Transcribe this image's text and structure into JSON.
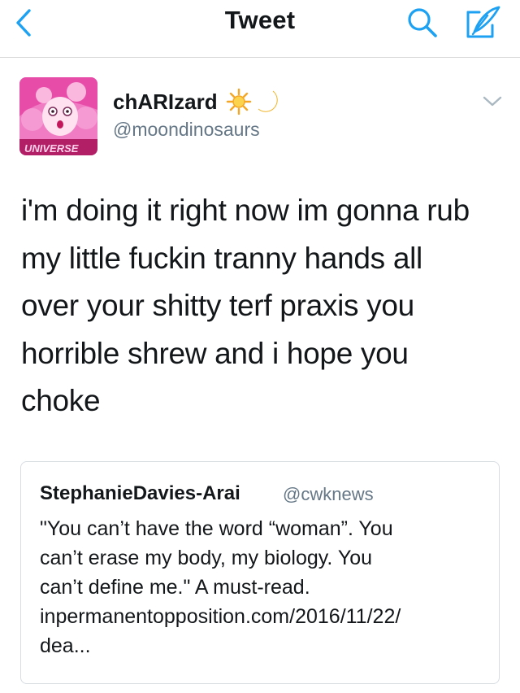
{
  "nav": {
    "title": "Tweet",
    "accent": "#1da1f2"
  },
  "author": {
    "name": "chARIzard",
    "handle": "@moondinosaurs",
    "emoji_icons": [
      "sun-icon",
      "crescent-moon-icon"
    ],
    "avatar_caption": "UNIVERSE"
  },
  "tweet": {
    "lines": [
      "i'm doing it right now im gonna rub",
      "my little fuckin tranny hands all",
      "over your shitty terf praxis you",
      "horrible shrew and i hope you",
      "choke"
    ]
  },
  "quoted": {
    "name": "StephanieDavies-Arai",
    "handle": "@cwknews",
    "lines": [
      "\"You can’t have the word “woman”. You",
      "can’t erase my body, my biology. You",
      "can’t define me.\" A must-read.",
      "inpermanentopposition.com/2016/11/22/",
      "dea..."
    ]
  }
}
